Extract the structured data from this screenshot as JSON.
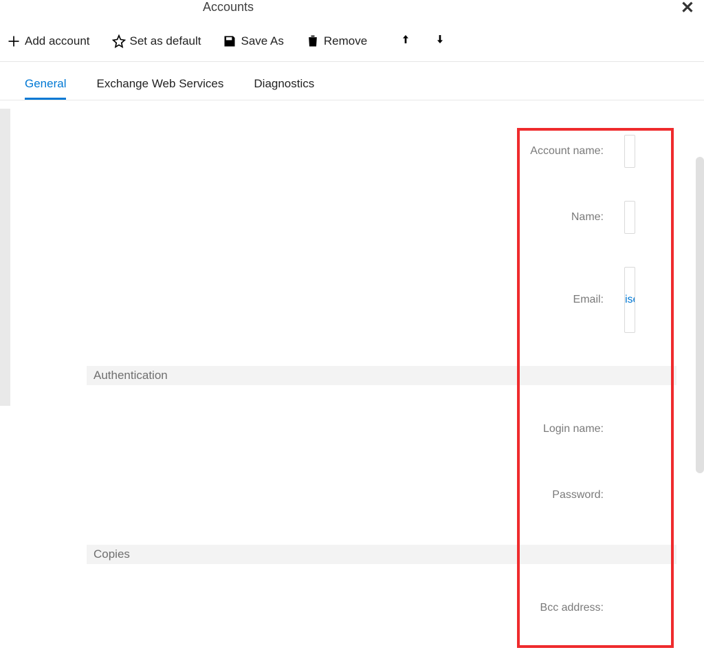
{
  "title": "Accounts",
  "toolbar": {
    "add": "Add account",
    "default": "Set as default",
    "saveas": "Save As",
    "remove": "Remove"
  },
  "tabs": {
    "general": "General",
    "ews": "Exchange Web Services",
    "diag": "Diagnostics"
  },
  "form": {
    "account_name": "Account name:",
    "name": "Name:",
    "email": "Email:",
    "email_fragment": "ise",
    "login": "Login name:",
    "password": "Password:",
    "bcc": "Bcc address:"
  },
  "sections": {
    "auth": "Authentication",
    "copies": "Copies"
  }
}
